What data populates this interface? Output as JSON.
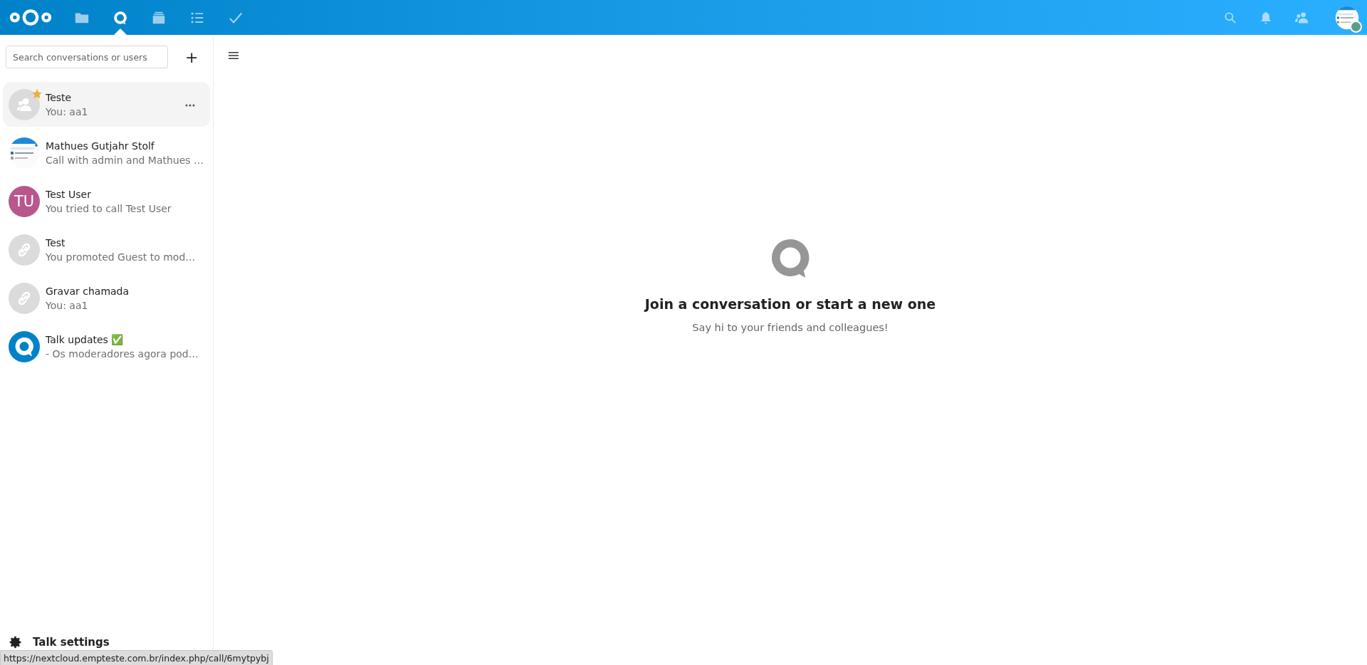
{
  "header": {
    "apps": [
      {
        "kind": "files",
        "selected": false
      },
      {
        "kind": "talk",
        "selected": true
      },
      {
        "kind": "deck",
        "selected": false
      },
      {
        "kind": "tasks",
        "selected": false
      },
      {
        "kind": "check",
        "selected": false
      }
    ],
    "online": true
  },
  "sidebar": {
    "search": {
      "placeholder": "Search conversations or users"
    },
    "new_button": "+",
    "conversations": [
      {
        "name": "Teste",
        "last_message": "You: aa1",
        "avatar": {
          "kind": "group"
        },
        "favorite": true,
        "selected": true
      },
      {
        "name": "Mathues Gutjahr Stolf",
        "last_message": "Call with admin and Mathues …",
        "favorite": false,
        "selected": false
      },
      {
        "name": "Test User",
        "last_message": "You tried to call Test User",
        "avatar": {
          "kind": "initials",
          "text": "TU"
        },
        "favorite": false,
        "selected": false
      },
      {
        "name": "Test",
        "last_message": "You promoted Guest to mod…",
        "avatar": {
          "kind": "link"
        },
        "favorite": false,
        "selected": false
      },
      {
        "name": "Gravar chamada",
        "last_message": "You: aa1",
        "avatar": {
          "kind": "link"
        },
        "favorite": false,
        "selected": false
      },
      {
        "name": "Talk updates ✅",
        "last_message": "- Os moderadores agora pod…",
        "avatar": {
          "kind": "talk"
        },
        "favorite": false,
        "selected": false
      }
    ],
    "settings": "Talk settings"
  },
  "empty_state": {
    "title": "Join a conversation or start a new one",
    "subtitle": "Say hi to your friends and colleagues!"
  },
  "link_preview": "https://nextcloud.empteste.com.br/index.php/call/6mytpybj"
}
